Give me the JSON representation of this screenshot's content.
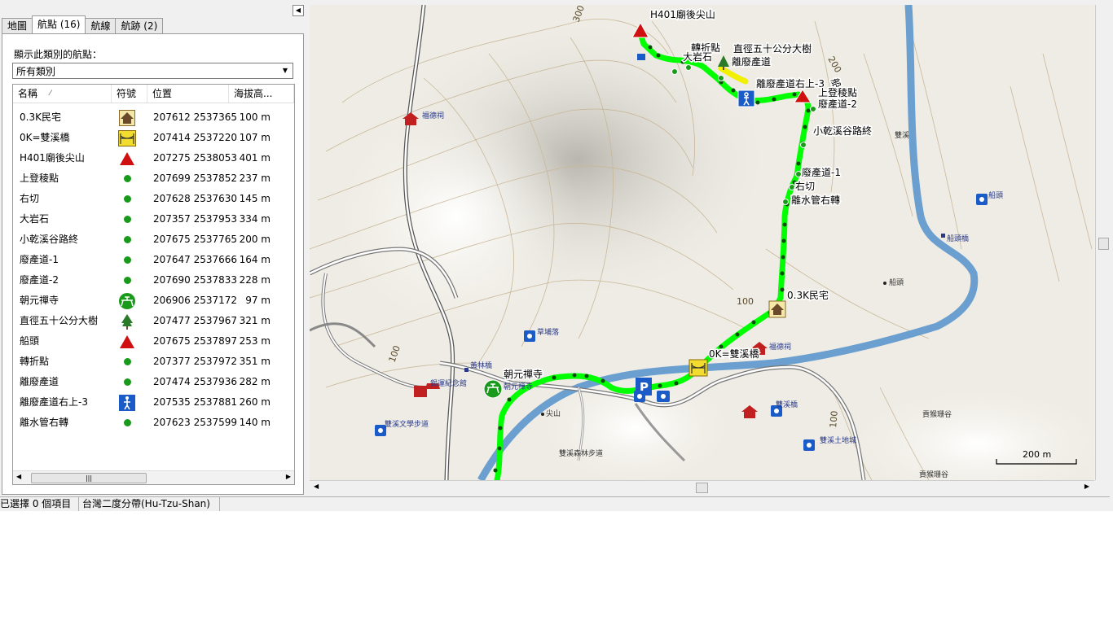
{
  "tabs": [
    {
      "label": "地圖"
    },
    {
      "label": "航點 (16)"
    },
    {
      "label": "航線"
    },
    {
      "label": "航跡 (2)"
    }
  ],
  "filter": {
    "label": "顯示此類別的航點：",
    "value": "所有類別"
  },
  "columns": {
    "name": "名稱",
    "symbol": "符號",
    "position": "位置",
    "altitude": "海拔高..."
  },
  "waypoints": [
    {
      "name": "0.3K民宅",
      "symbol": "house-icon",
      "position": "207612 2537365",
      "altitude": "100 m"
    },
    {
      "name": "0K=雙溪橋",
      "symbol": "bridge-icon",
      "position": "207414 2537220",
      "altitude": "107 m"
    },
    {
      "name": "H401廟後尖山",
      "symbol": "summit-icon",
      "position": "207275 2538053",
      "altitude": "401 m"
    },
    {
      "name": "上登稜點",
      "symbol": "dot-icon",
      "position": "207699 2537852",
      "altitude": "237 m"
    },
    {
      "name": "右切",
      "symbol": "dot-icon",
      "position": "207628 2537630",
      "altitude": "145 m"
    },
    {
      "name": "大岩石",
      "symbol": "dot-icon",
      "position": "207357 2537953",
      "altitude": "334 m"
    },
    {
      "name": "小乾溪谷路終",
      "symbol": "dot-icon",
      "position": "207675 2537765",
      "altitude": "200 m"
    },
    {
      "name": "廢產道-1",
      "symbol": "dot-icon",
      "position": "207647 2537666",
      "altitude": "164 m"
    },
    {
      "name": "廢產道-2",
      "symbol": "dot-icon",
      "position": "207690 2537833",
      "altitude": "228 m"
    },
    {
      "name": "朝元禪寺",
      "symbol": "picnic-icon",
      "position": "206906 2537172",
      "altitude": "97 m"
    },
    {
      "name": "直徑五十公分大樹",
      "symbol": "tree-icon",
      "position": "207477 2537967",
      "altitude": "321 m"
    },
    {
      "name": "船頭",
      "symbol": "summit-icon",
      "position": "207675 2537897",
      "altitude": "253 m"
    },
    {
      "name": "轉折點",
      "symbol": "dot-icon",
      "position": "207377 2537972",
      "altitude": "351 m"
    },
    {
      "name": "離廢產道",
      "symbol": "dot-icon",
      "position": "207474 2537936",
      "altitude": "282 m"
    },
    {
      "name": "離廢產道右上-3",
      "symbol": "hiker-icon",
      "position": "207535 2537881",
      "altitude": "260 m"
    },
    {
      "name": "離水管右轉",
      "symbol": "dot-icon",
      "position": "207623 2537599",
      "altitude": "140 m"
    }
  ],
  "map": {
    "labels": {
      "summit": "H401廟後尖山",
      "turn": "轉折點",
      "rock": "大岩石",
      "tree": "直徑五十公分大樹",
      "leave": "離廢產道",
      "leave3": "離廢產道右上-3",
      "chuantou": "船頭",
      "ridge": "上登稜點",
      "road2": "廢產道-2",
      "valley": "小乾溪谷路終",
      "road1": "廢產道-1",
      "rightcut": "右切",
      "pipe": "離水管右轉",
      "house": "0.3K民宅",
      "bridge": "0K=雙溪橋",
      "temple": "朝元禪寺",
      "contour300": "300",
      "contour200": "200",
      "contour100a": "100",
      "contour100b": "100",
      "contour100c": "100",
      "scale": "200 m"
    },
    "base_labels": {
      "fude1": "福德祠",
      "fude2": "福德祠",
      "shuangxi": "雙溪",
      "chuantou_poi": "船頭",
      "chuantou_bridge": "船頭橋",
      "chuantou2": "船頭",
      "caopu": "草埔落",
      "huanglin": "黃林橋",
      "memorial": "錫運紀念館",
      "chaoyuan_poi": "朝元禪寺",
      "jianshan": "尖山",
      "trail": "雙溪文學步道",
      "forest": "雙溪森林步道",
      "east_bridge": "雙溪橋",
      "soil": "雙溪土地城",
      "gufeng1": "貢猴珊谷",
      "gufeng2": "貢猴珊谷"
    }
  },
  "status": {
    "selected": "已選擇 0 個項目",
    "datum": "台灣二度分帶(Hu-Tzu-Shan)"
  }
}
